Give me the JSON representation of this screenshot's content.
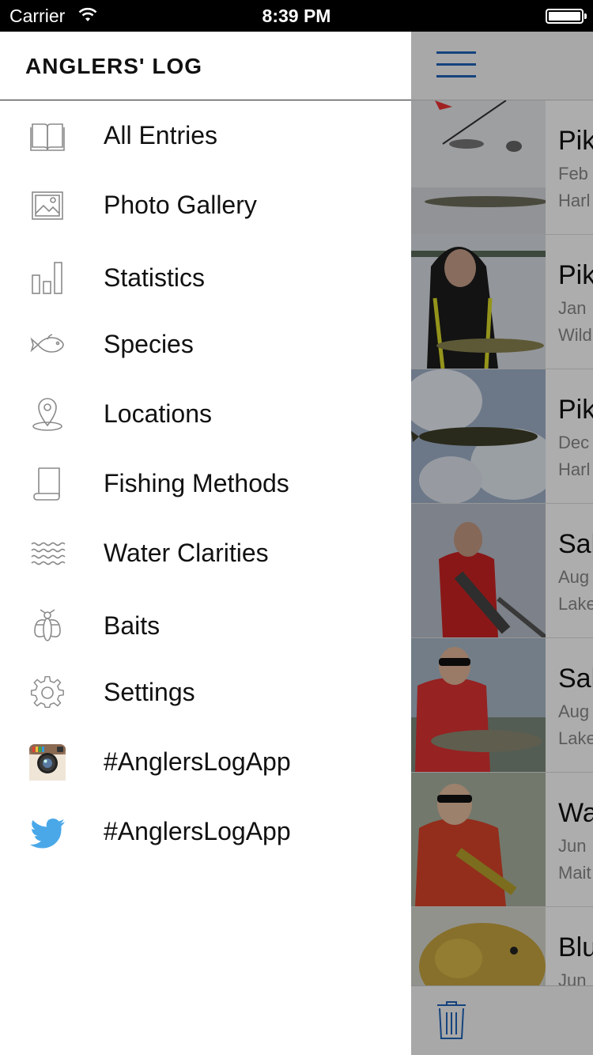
{
  "status_bar": {
    "carrier": "Carrier",
    "time": "8:39 PM"
  },
  "drawer": {
    "title": "ANGLERS' LOG",
    "items": [
      {
        "label": "All Entries",
        "icon": "book-icon"
      },
      {
        "label": "Photo Gallery",
        "icon": "image-icon"
      },
      {
        "label": "Statistics",
        "icon": "bar-chart-icon"
      },
      {
        "label": "Species",
        "icon": "fish-icon"
      },
      {
        "label": "Locations",
        "icon": "map-pin-icon"
      },
      {
        "label": "Fishing Methods",
        "icon": "scroll-icon"
      },
      {
        "label": "Water Clarities",
        "icon": "waves-icon"
      },
      {
        "label": "Baits",
        "icon": "fly-icon"
      },
      {
        "label": "Settings",
        "icon": "gear-icon"
      },
      {
        "label": "#AnglersLogApp",
        "icon": "instagram-icon"
      },
      {
        "label": "#AnglersLogApp",
        "icon": "twitter-icon"
      }
    ]
  },
  "entries": [
    {
      "title": "Pik",
      "date": "Feb",
      "location": "Harl"
    },
    {
      "title": "Pik",
      "date": "Jan",
      "location": "Wild"
    },
    {
      "title": "Pik",
      "date": "Dec",
      "location": "Harl"
    },
    {
      "title": "Sal",
      "date": "Aug",
      "location": "Lake"
    },
    {
      "title": "Sal",
      "date": "Aug",
      "location": "Lake"
    },
    {
      "title": "Wa",
      "date": "Jun",
      "location": "Mait"
    },
    {
      "title": "Blu",
      "date": "Jun",
      "location": ""
    }
  ],
  "colors": {
    "accent": "#1f64b8",
    "icon_gray": "#8a8a8a",
    "twitter": "#4aa8e8"
  }
}
